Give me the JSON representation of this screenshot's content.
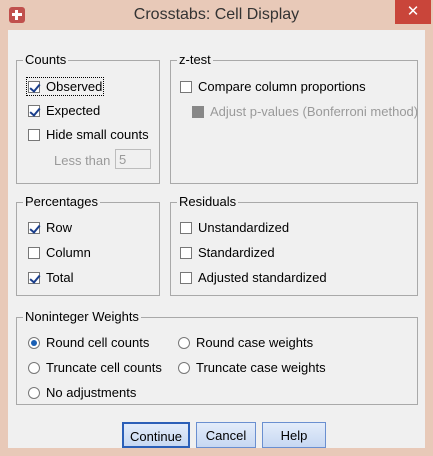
{
  "window": {
    "title": "Crosstabs: Cell Display",
    "close_glyph": "✕",
    "icon": "spss-app-icon"
  },
  "counts": {
    "title": "Counts",
    "observed": {
      "label": "Observed",
      "checked": true
    },
    "expected": {
      "label": "Expected",
      "checked": true
    },
    "hide_small": {
      "label": "Hide small counts",
      "checked": false
    },
    "less_than_label": "Less than",
    "less_than_value": "5"
  },
  "ztest": {
    "title": "z-test",
    "compare": {
      "label": "Compare column proportions",
      "checked": false
    },
    "adjust": {
      "label": "Adjust p-values (Bonferroni method)",
      "checked": false,
      "enabled": false
    }
  },
  "percentages": {
    "title": "Percentages",
    "row": {
      "label": "Row",
      "checked": true
    },
    "column": {
      "label": "Column",
      "checked": false
    },
    "total": {
      "label": "Total",
      "checked": true
    }
  },
  "residuals": {
    "title": "Residuals",
    "unstandardized": {
      "label": "Unstandardized",
      "checked": false
    },
    "standardized": {
      "label": "Standardized",
      "checked": false
    },
    "adjusted": {
      "label": "Adjusted standardized",
      "checked": false
    }
  },
  "weights": {
    "title": "Noninteger Weights",
    "round_cell": {
      "label": "Round cell counts",
      "selected": true
    },
    "round_case": {
      "label": "Round case weights",
      "selected": false
    },
    "truncate_cell": {
      "label": "Truncate cell counts",
      "selected": false
    },
    "truncate_case": {
      "label": "Truncate case weights",
      "selected": false
    },
    "no_adjust": {
      "label": "No adjustments",
      "selected": false
    }
  },
  "buttons": {
    "continue": "Continue",
    "cancel": "Cancel",
    "help": "Help"
  },
  "colors": {
    "titlebar": "#e8c9b8",
    "close": "#c9453a",
    "client": "#f0f0f0",
    "check": "#1a3e8c"
  }
}
